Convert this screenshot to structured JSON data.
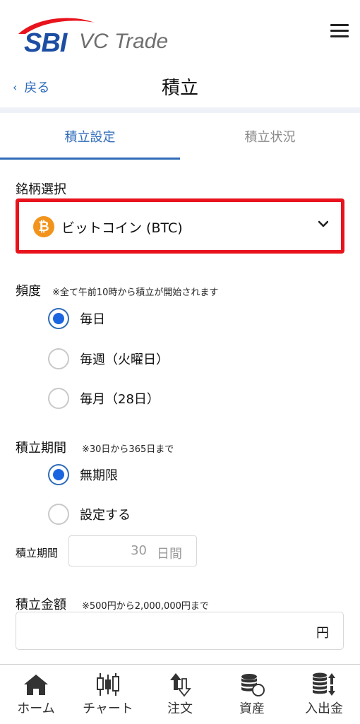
{
  "header": {
    "logo_sbi": "SBI",
    "logo_text": "VC Trade",
    "back_label": "戻る",
    "title": "積立"
  },
  "tabs": [
    {
      "label": "積立設定",
      "active": true
    },
    {
      "label": "積立状況",
      "active": false
    }
  ],
  "brand": {
    "label": "銘柄選択",
    "selected": "ビットコイン (BTC)",
    "icon_char": "₿",
    "icon_color": "#f2941c"
  },
  "frequency": {
    "label": "頻度",
    "note": "※全て午前10時から積立が開始されます",
    "options": [
      {
        "label": "毎日",
        "selected": true
      },
      {
        "label": "毎週（火曜日）",
        "selected": false
      },
      {
        "label": "毎月（28日）",
        "selected": false
      }
    ]
  },
  "period": {
    "label": "積立期間",
    "note": "※30日から365日まで",
    "options": [
      {
        "label": "無期限",
        "selected": true
      },
      {
        "label": "設定する",
        "selected": false
      }
    ],
    "input_label": "積立期間",
    "input_value": "30",
    "input_unit": "日間"
  },
  "amount": {
    "label": "積立金額",
    "note": "※500円から2,000,000円まで",
    "value": "",
    "unit": "円"
  },
  "bottom_nav": [
    {
      "label": "ホーム",
      "icon": "home-icon"
    },
    {
      "label": "チャート",
      "icon": "chart-icon"
    },
    {
      "label": "注文",
      "icon": "order-icon"
    },
    {
      "label": "資産",
      "icon": "assets-icon"
    },
    {
      "label": "入出金",
      "icon": "deposit-icon"
    }
  ],
  "colors": {
    "accent": "#2f6bb8",
    "radio_fill": "#1a66e0",
    "highlight_border": "#e8131c"
  }
}
